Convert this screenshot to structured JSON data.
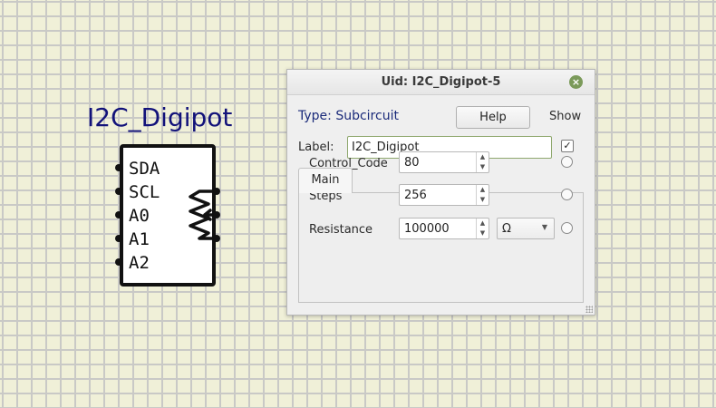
{
  "component": {
    "title": "I2C_Digipot",
    "pins": [
      "SDA",
      "SCL",
      "A0",
      "A1",
      "A2"
    ]
  },
  "dialog": {
    "title": "Uid: I2C_Digipot-5",
    "type_text": "Type: Subcircuit",
    "help_label": "Help",
    "show_label": "Show",
    "label_caption": "Label:",
    "label_value": "I2C_Digipot",
    "label_shown": true,
    "check_mark": "✓",
    "close_glyph": "×",
    "tabs": [
      {
        "label": "Main",
        "selected": true
      }
    ],
    "properties": [
      {
        "name": "Control_Code",
        "value": "80"
      },
      {
        "name": "Steps",
        "value": "256"
      },
      {
        "name": "Resistance",
        "value": "100000",
        "unit": "Ω"
      }
    ]
  },
  "colors": {
    "canvas_bg": "#f0f0d8",
    "grid": "#c9c9c6",
    "component_title": "#12127a",
    "type_text": "#1a2a7a",
    "focus_border": "#8fa86e",
    "close_button": "#7b9a5a"
  },
  "icons": {
    "close": "close-icon",
    "spin": "spin-arrows-icon",
    "dropdown": "chevron-down-icon"
  }
}
